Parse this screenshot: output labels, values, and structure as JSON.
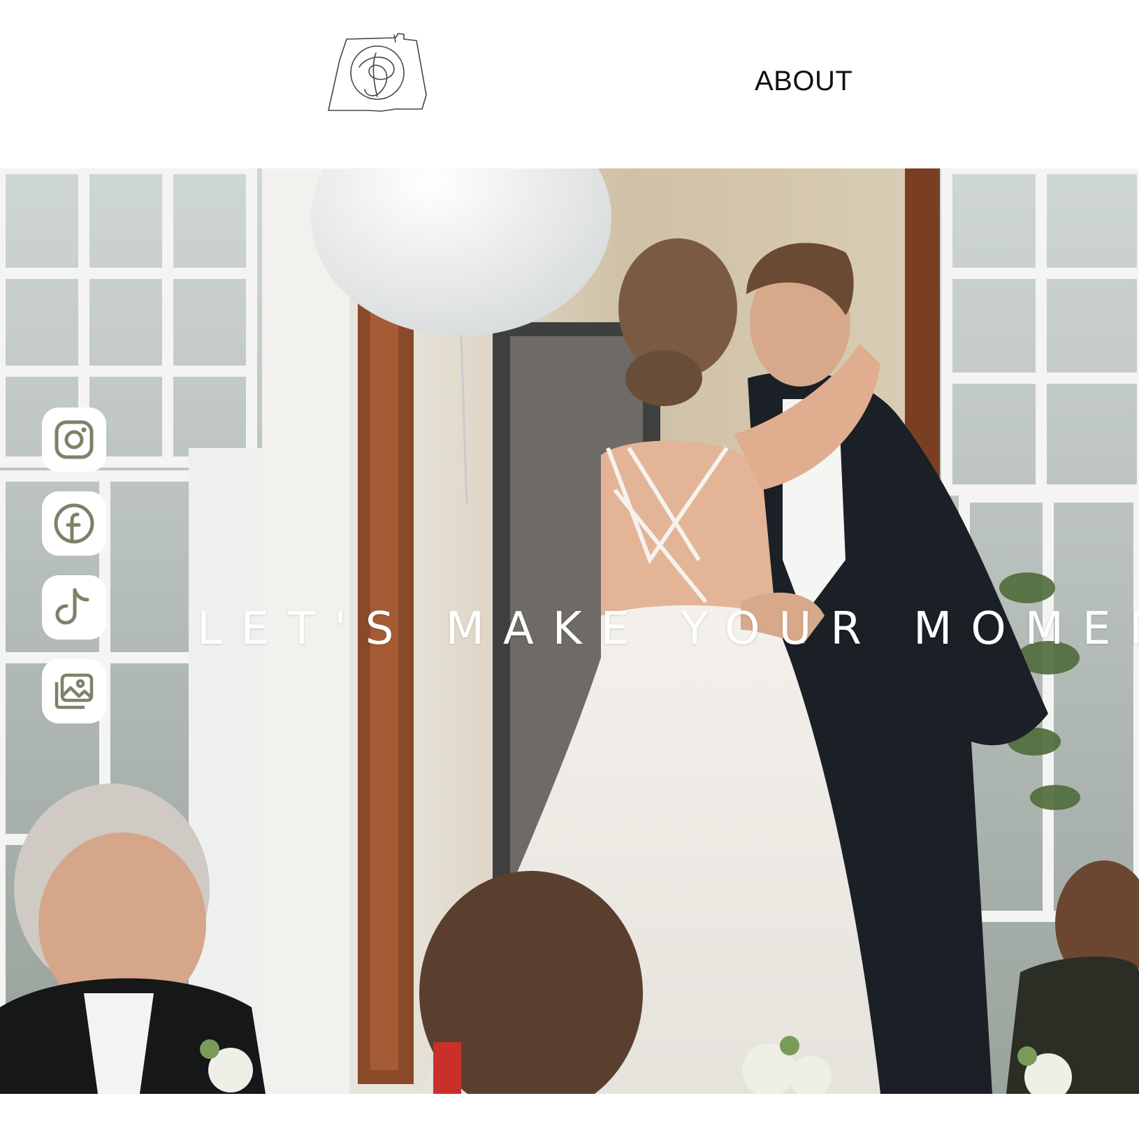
{
  "header": {
    "logo_name": "circle-monogram-logo",
    "nav": {
      "about_label": "ABOUT"
    }
  },
  "hero": {
    "headline": "LET'S MAKE YOUR MOMENT",
    "image_description_icon": "wedding-kiss-photo"
  },
  "social": {
    "items": [
      {
        "icon": "instagram-icon"
      },
      {
        "icon": "facebook-icon"
      },
      {
        "icon": "tiktok-icon"
      },
      {
        "icon": "gallery-icon"
      }
    ],
    "icon_color": "#7d8268"
  },
  "colors": {
    "background": "#ffffff",
    "text_dark": "#111111",
    "headline": "#ffffff",
    "accent_olive": "#7d8268"
  }
}
